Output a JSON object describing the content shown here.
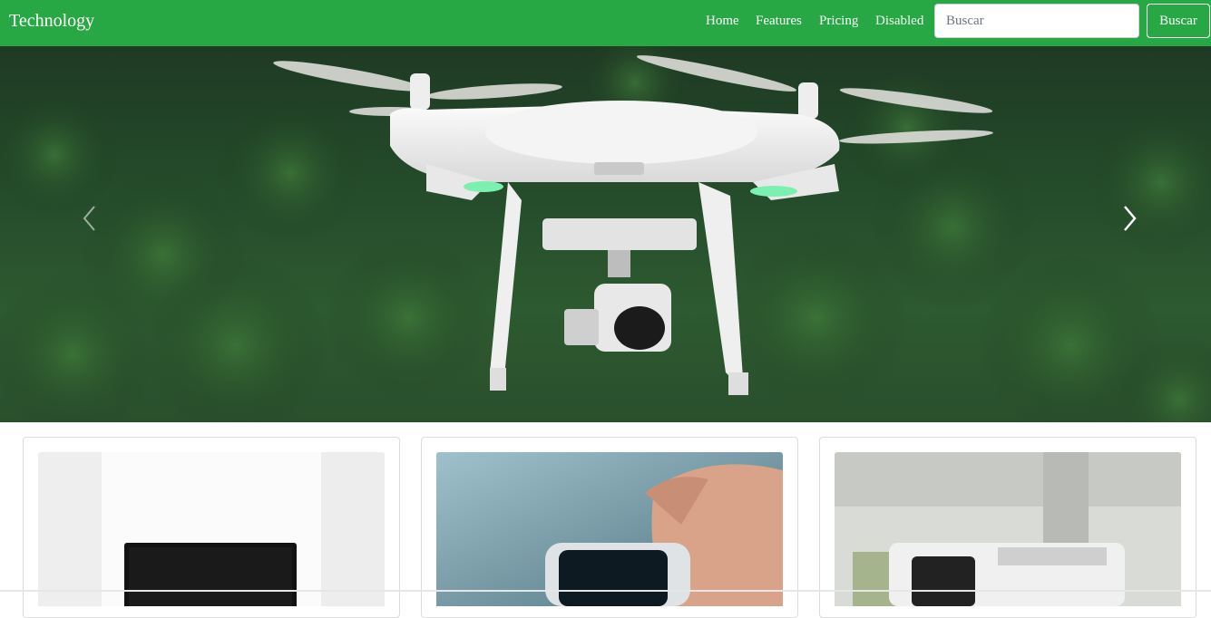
{
  "navbar": {
    "brand": "Technology",
    "links": [
      {
        "label": "Home"
      },
      {
        "label": "Features"
      },
      {
        "label": "Pricing"
      },
      {
        "label": "Disabled",
        "disabled": true
      }
    ],
    "search": {
      "placeholder": "Buscar",
      "value": ""
    },
    "search_button": "Buscar",
    "background_color": "#28a745"
  },
  "carousel": {
    "prev_icon": "chevron-left-icon",
    "next_icon": "chevron-right-icon"
  },
  "cards": [
    {
      "image": "laptop-photo"
    },
    {
      "image": "smartwatch-photo"
    },
    {
      "image": "camera-photo"
    }
  ]
}
